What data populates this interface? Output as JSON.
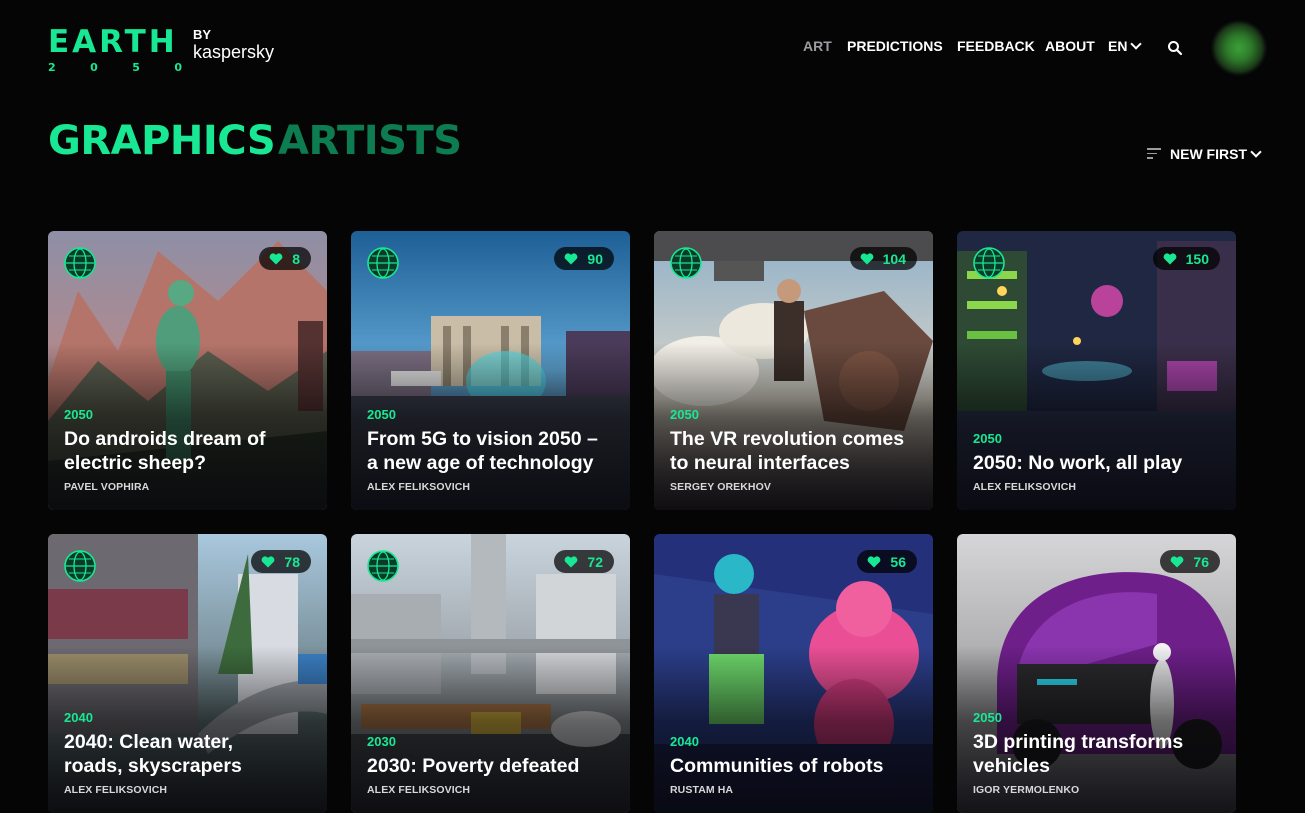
{
  "header": {
    "logo": {
      "wordmark": "EARTH",
      "year_digits": [
        "2",
        "0",
        "5",
        "0"
      ],
      "by": "BY",
      "brand": "kaspersky"
    },
    "nav": [
      {
        "label": "ART",
        "active": true
      },
      {
        "label": "PREDICTIONS"
      },
      {
        "label": "FEEDBACK"
      },
      {
        "label": "ABOUT"
      },
      {
        "label": "EN"
      }
    ],
    "search_icon": "search-icon",
    "avatar_icon": "avatar"
  },
  "tabs": {
    "graphics": "GRAPHICS",
    "artists": "ARTISTS"
  },
  "sort": {
    "label": "NEW FIRST",
    "icon": "sort-icon"
  },
  "colors": {
    "accent": "#18e894",
    "accent_dark": "#0d7c51",
    "background": "#050506"
  },
  "cards": [
    {
      "year": "2050",
      "title_line1": "Do androids dream of",
      "title_line2": "electric sheep?",
      "author": "PAVEL VOPHIRA",
      "likes": "8"
    },
    {
      "year": "2050",
      "title_line1": "From 5G to vision 2050 –",
      "title_line2": "a new age of technology",
      "author": "ALEX FELIKSOVICH",
      "likes": "90"
    },
    {
      "year": "2050",
      "title_line1": "The VR revolution comes",
      "title_line2": "to neural interfaces",
      "author": "SERGEY OREKHOV",
      "likes": "104"
    },
    {
      "year": "2050",
      "title_line1": "2050: No work, all play",
      "title_line2": "",
      "author": "ALEX FELIKSOVICH",
      "likes": "150"
    },
    {
      "year": "2040",
      "title_line1": "2040: Clean water,",
      "title_line2": "roads, skyscrapers",
      "author": "ALEX FELIKSOVICH",
      "likes": "78"
    },
    {
      "year": "2030",
      "title_line1": "2030: Poverty defeated",
      "title_line2": "",
      "author": "ALEX FELIKSOVICH",
      "likes": "72"
    },
    {
      "year": "2040",
      "title_line1": "Communities of robots",
      "title_line2": "",
      "author": "RUSTAM HA",
      "likes": "56"
    },
    {
      "year": "2050",
      "title_line1": "3D printing transforms",
      "title_line2": "vehicles",
      "author": "IGOR YERMOLENKO",
      "likes": "76"
    }
  ]
}
